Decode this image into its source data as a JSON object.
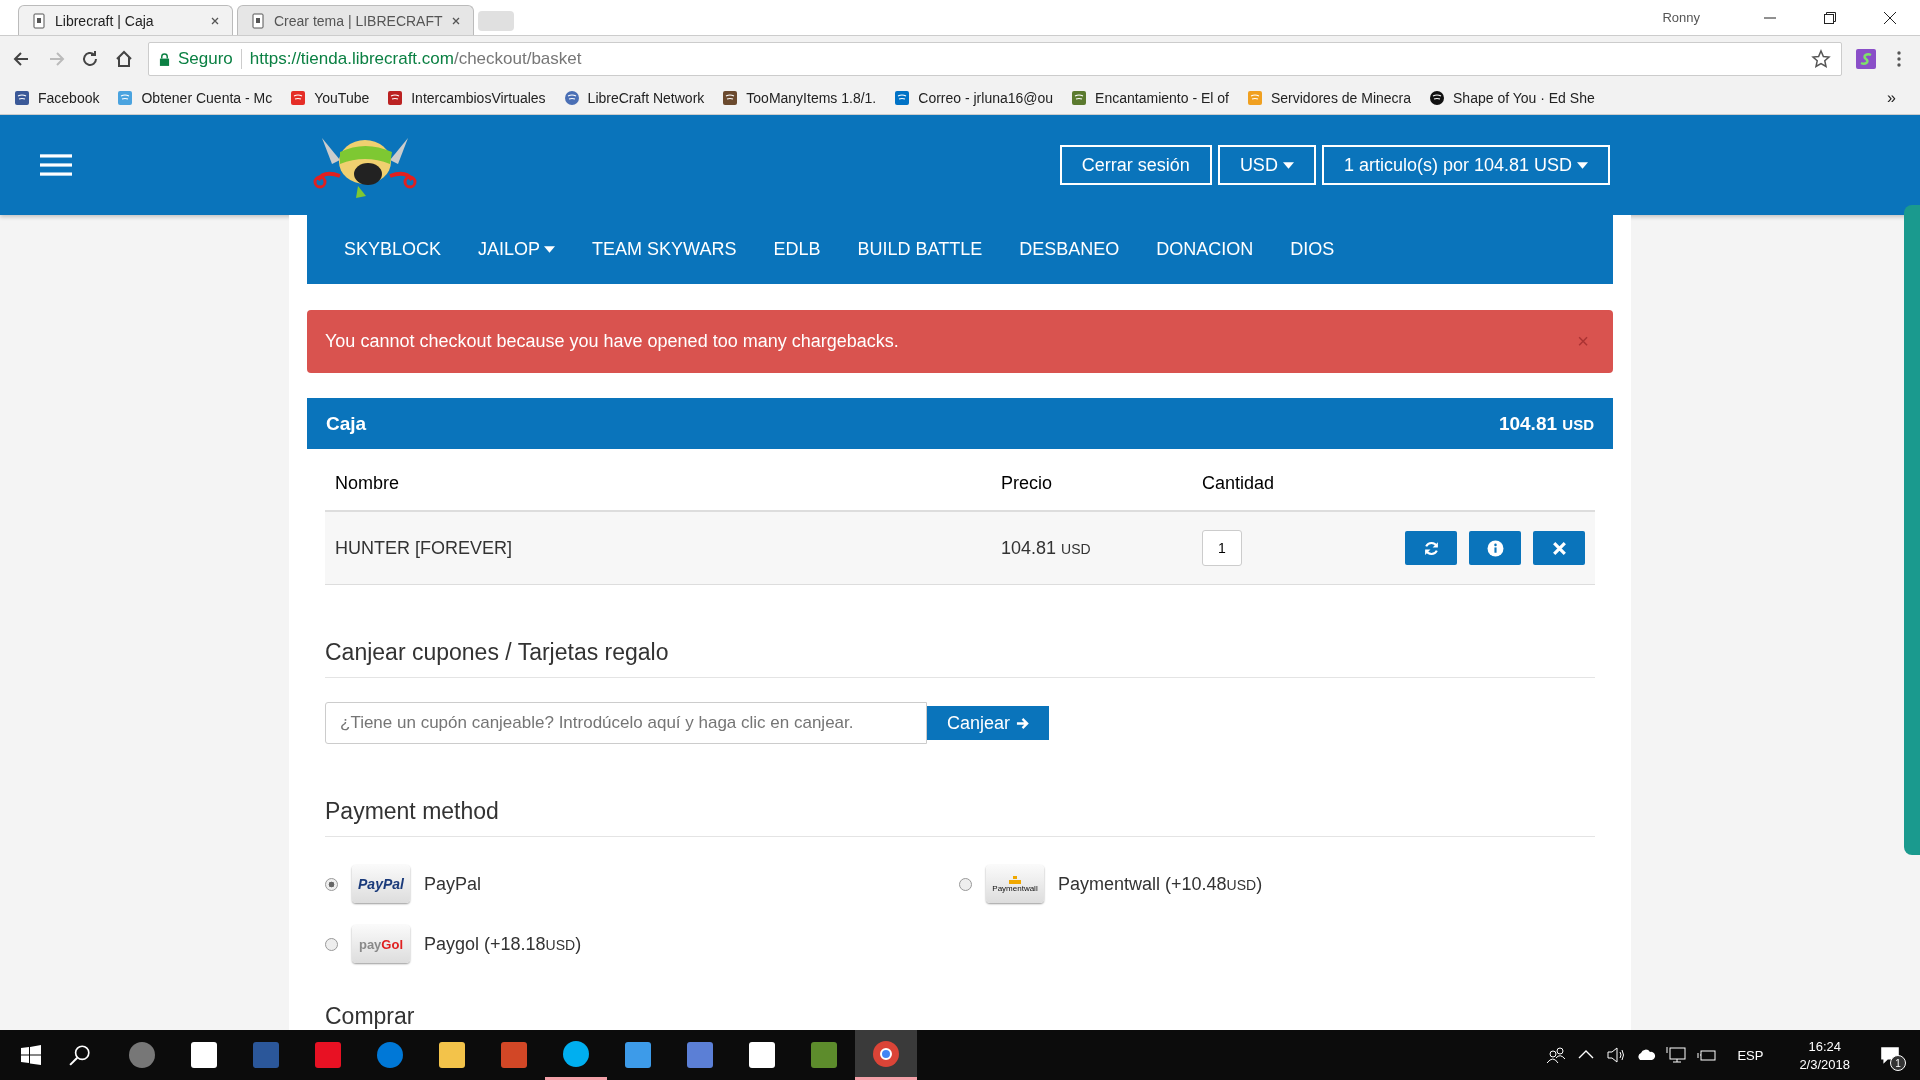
{
  "browser": {
    "tabs": [
      {
        "title": "Librecraft | Caja",
        "selected": true
      },
      {
        "title": "Crear tema | LIBRECRAFT",
        "selected": false
      }
    ],
    "user": "Ronny",
    "secure_label": "Seguro",
    "url_host": "https://tienda.librecraft.com",
    "url_path": "/checkout/basket",
    "bookmarks": [
      {
        "kind": "facebook",
        "label": "Facebook"
      },
      {
        "kind": "gift",
        "label": "Obtener Cuenta - Mc"
      },
      {
        "kind": "youtube",
        "label": "YouTube"
      },
      {
        "kind": "iv",
        "label": "IntercambiosVirtuales"
      },
      {
        "kind": "shield",
        "label": "LibreCraft Network"
      },
      {
        "kind": "book",
        "label": "TooManyItems 1.8/1."
      },
      {
        "kind": "mail",
        "label": "Correo - jrluna16@ou"
      },
      {
        "kind": "block",
        "label": "Encantamiento - El of"
      },
      {
        "kind": "rainbow",
        "label": "Servidores de Minecra"
      },
      {
        "kind": "spotify",
        "label": "Shape of You · Ed She"
      }
    ],
    "more": "»"
  },
  "site": {
    "buttons": [
      {
        "label": "Cerrar sesión",
        "dropdown": false
      },
      {
        "label": "USD",
        "dropdown": true
      },
      {
        "label": "1 articulo(s) por 104.81 USD",
        "dropdown": true
      }
    ],
    "nav": [
      {
        "label": "SKYBLOCK",
        "dropdown": false
      },
      {
        "label": "JAILOP",
        "dropdown": true
      },
      {
        "label": "TEAM SKYWARS",
        "dropdown": false
      },
      {
        "label": "EDLB",
        "dropdown": false
      },
      {
        "label": "BUILD BATTLE",
        "dropdown": false
      },
      {
        "label": "DESBANEO",
        "dropdown": false
      },
      {
        "label": "DONACION",
        "dropdown": false
      },
      {
        "label": "DIOS",
        "dropdown": false
      }
    ],
    "alert": {
      "message": "You cannot checkout because you have opened too many chargebacks.",
      "close": "×"
    },
    "basket": {
      "title": "Caja",
      "total": "104.81",
      "currency": "USD",
      "columns": [
        "Nombre",
        "Precio",
        "Cantidad"
      ],
      "rows": [
        {
          "name": "HUNTER [FOREVER]",
          "price": "104.81",
          "currency": "USD",
          "quantity": "1"
        }
      ]
    },
    "coupons": {
      "title": "Canjear cupones / Tarjetas regalo",
      "placeholder": "¿Tiene un cupón canjeable? Introdúcelo aquí y haga clic en canjear.",
      "button": "Canjear"
    },
    "payment": {
      "title": "Payment method",
      "methods": [
        {
          "kind": "paypal",
          "logo_a": "PayPal",
          "label": "PayPal",
          "selected": true
        },
        {
          "kind": "paymentwall",
          "logo_a": "Paymentwall",
          "label": "Paymentwall (+10.48",
          "currency": "USD",
          "suffix": ")",
          "selected": false
        },
        {
          "kind": "paygol",
          "logo_a": "pay",
          "logo_b": "Gol",
          "label": "Paygol (+18.18",
          "currency": "USD",
          "suffix": ")",
          "selected": false
        }
      ]
    },
    "next_section": "Comprar"
  },
  "taskbar": {
    "apps": [
      {
        "kind": "cortana",
        "running": false,
        "selected": false
      },
      {
        "kind": "store",
        "running": false,
        "selected": false
      },
      {
        "kind": "word",
        "running": false,
        "selected": false
      },
      {
        "kind": "music",
        "running": false,
        "selected": false
      },
      {
        "kind": "edge",
        "running": false,
        "selected": false
      },
      {
        "kind": "folder",
        "running": false,
        "selected": false
      },
      {
        "kind": "powerpoint",
        "running": false,
        "selected": false
      },
      {
        "kind": "skype",
        "running": true,
        "selected": false
      },
      {
        "kind": "video",
        "running": false,
        "selected": false
      },
      {
        "kind": "network",
        "running": false,
        "selected": false
      },
      {
        "kind": "four",
        "running": false,
        "selected": false
      },
      {
        "kind": "grass",
        "running": false,
        "selected": false
      },
      {
        "kind": "chrome",
        "running": true,
        "selected": true
      }
    ],
    "language": "ESP",
    "time": "16:24",
    "date": "2/3/2018",
    "notifications": "1"
  }
}
